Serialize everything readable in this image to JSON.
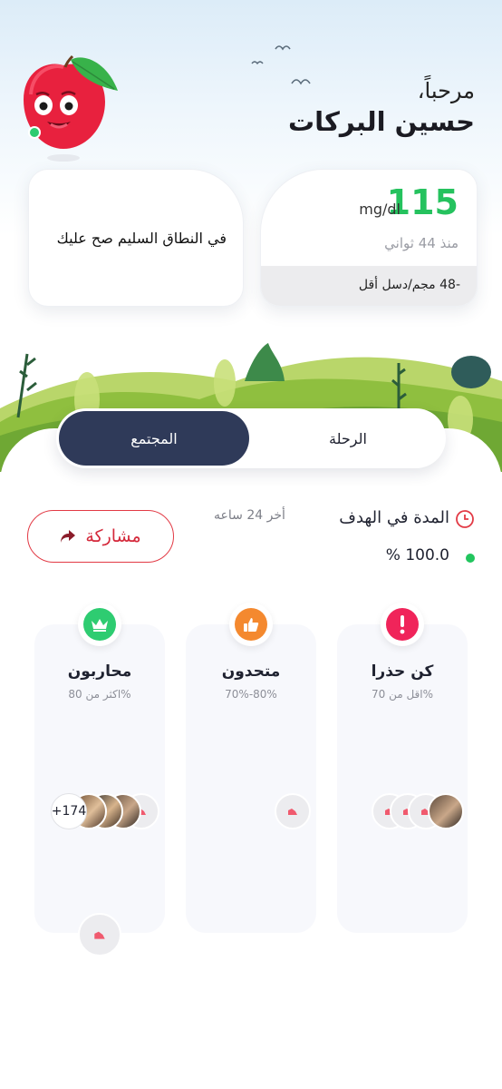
{
  "header": {
    "greeting": "مرحباً،",
    "user_name": "حسين البركات"
  },
  "glucose_card": {
    "value": "115",
    "unit": "mg/dl",
    "time_ago": "منذ 44 ثواني",
    "change": "-48 مجم/دسل أقل"
  },
  "status_card": {
    "message": "في النطاق السليم صح عليك"
  },
  "tabs": [
    {
      "label": "الرحلة",
      "active": false
    },
    {
      "label": "المجتمع",
      "active": true
    }
  ],
  "time_in_target": {
    "label": "المدة في الهدف",
    "period": "أخر 24 ساعه",
    "value": "% 100.0"
  },
  "share_button": {
    "label": "مشاركة"
  },
  "groups": [
    {
      "title": "كن حذرا",
      "range": "اقل من 70%",
      "icon": "alert-icon",
      "color": "#f0245a",
      "extra_count": ""
    },
    {
      "title": "متحدون",
      "range": "70%-80%",
      "icon": "thumbs-up-icon",
      "color": "#f4892f",
      "extra_count": ""
    },
    {
      "title": "محاربون",
      "range": "اكثر من 80%",
      "icon": "crown-icon",
      "color": "#2ecc71",
      "extra_count": "+174"
    }
  ],
  "colors": {
    "accent_green": "#25c25e",
    "tab_active": "#2f3a59",
    "share_red": "#e23a45"
  }
}
